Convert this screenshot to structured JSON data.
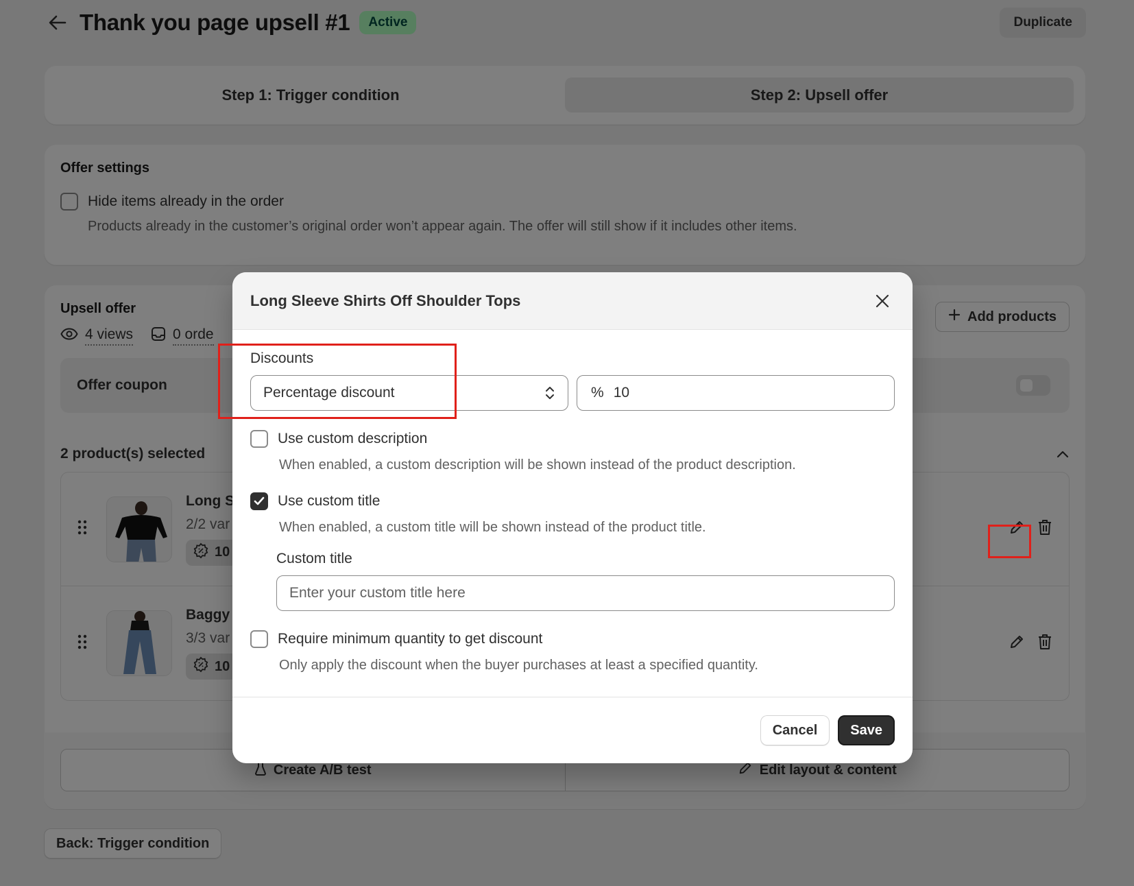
{
  "header": {
    "title": "Thank you page upsell #1",
    "status_badge": "Active",
    "duplicate_label": "Duplicate"
  },
  "steps": [
    {
      "label": "Step 1: Trigger condition",
      "active": false
    },
    {
      "label": "Step 2: Upsell offer",
      "active": true
    }
  ],
  "offer_settings": {
    "title": "Offer settings",
    "hide_items_label": "Hide items already in the order",
    "hide_items_help": "Products already in the customer’s original order won’t appear again. The offer will still show if it includes other items."
  },
  "upsell_offer": {
    "title": "Upsell offer",
    "views": "4 views",
    "orders": "0 orde",
    "add_products_label": "Add products",
    "coupon_label": "Offer coupon",
    "selected_label": "2 product(s) selected",
    "products": [
      {
        "name": "Long S",
        "variants": "2/2 var",
        "badge": "10"
      },
      {
        "name": "Baggy",
        "variants": "3/3 var",
        "badge": "10"
      }
    ],
    "create_ab_label": "Create A/B test",
    "edit_layout_label": "Edit layout & content"
  },
  "back_label": "Back: Trigger condition",
  "modal": {
    "title": "Long Sleeve Shirts Off Shoulder Tops",
    "discounts_label": "Discounts",
    "discount_type": "Percentage discount",
    "percent_symbol": "%",
    "percent_value": "10",
    "custom_description_label": "Use custom description",
    "custom_description_help": "When enabled, a custom description will be shown instead of the product description.",
    "custom_title_check_label": "Use custom title",
    "custom_title_help": "When enabled, a custom title will be shown instead of the product title.",
    "custom_title_field_label": "Custom title",
    "custom_title_placeholder": "Enter your custom title here",
    "min_qty_label": "Require minimum quantity to get discount",
    "min_qty_help": "Only apply the discount when the buyer purchases at least a specified quantity.",
    "cancel_label": "Cancel",
    "save_label": "Save"
  },
  "colors": {
    "highlight": "#e0201a",
    "primary_button": "#303030",
    "active_badge": "#affebf"
  }
}
